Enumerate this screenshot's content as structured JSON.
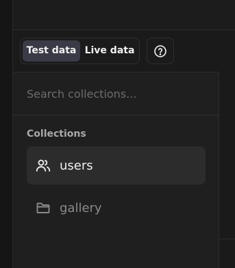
{
  "mode_toggle": {
    "options": [
      "Test data",
      "Live data"
    ],
    "selected": "Test data"
  },
  "help": {
    "icon": "help-circle-icon"
  },
  "search": {
    "placeholder": "Search collections..."
  },
  "collections": {
    "heading": "Collections",
    "items": [
      {
        "label": "users",
        "icon": "users-icon",
        "selected": true
      },
      {
        "label": "gallery",
        "icon": "folder-icon",
        "selected": false
      }
    ]
  },
  "colors": {
    "background": "#1a1a1a",
    "panel": "#1f1f1f",
    "active_toggle": "#3b3b47",
    "active_item": "#2c2c2c",
    "text": "#e8e8e8",
    "muted": "#8a8a8a"
  }
}
